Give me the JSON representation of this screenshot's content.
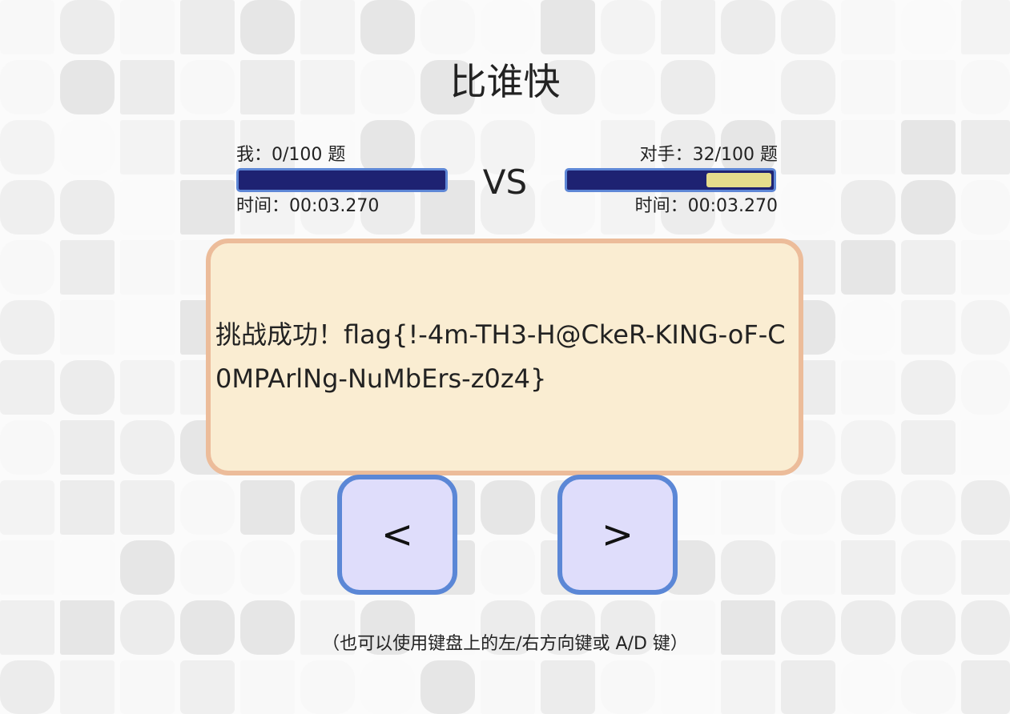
{
  "title": "比谁快",
  "me": {
    "progress_label": "我：0/100 题",
    "time_label": "时间：00:03.270",
    "progress": 0
  },
  "opponent": {
    "progress_label": "对手：32/100 题",
    "time_label": "时间：00:03.270",
    "progress": 0.32
  },
  "vs_label": "VS",
  "message": "挑战成功！flag{!-4m-TH3-H@CkeR-KING-oF-C0MPArlNg-NuMbErs-z0z4}",
  "buttons": {
    "left_label": "<",
    "right_label": ">"
  },
  "hint": "（也可以使用键盘上的左/右方向键或 A/D 键）",
  "colors": {
    "bar_background": "#1e2272",
    "bar_fill": "#e5dc8c",
    "bar_border": "#5e87d6",
    "message_background": "#faedd2",
    "message_border": "#ecbc9a",
    "button_background": "#dfddfb",
    "button_border": "#5b87d6"
  }
}
